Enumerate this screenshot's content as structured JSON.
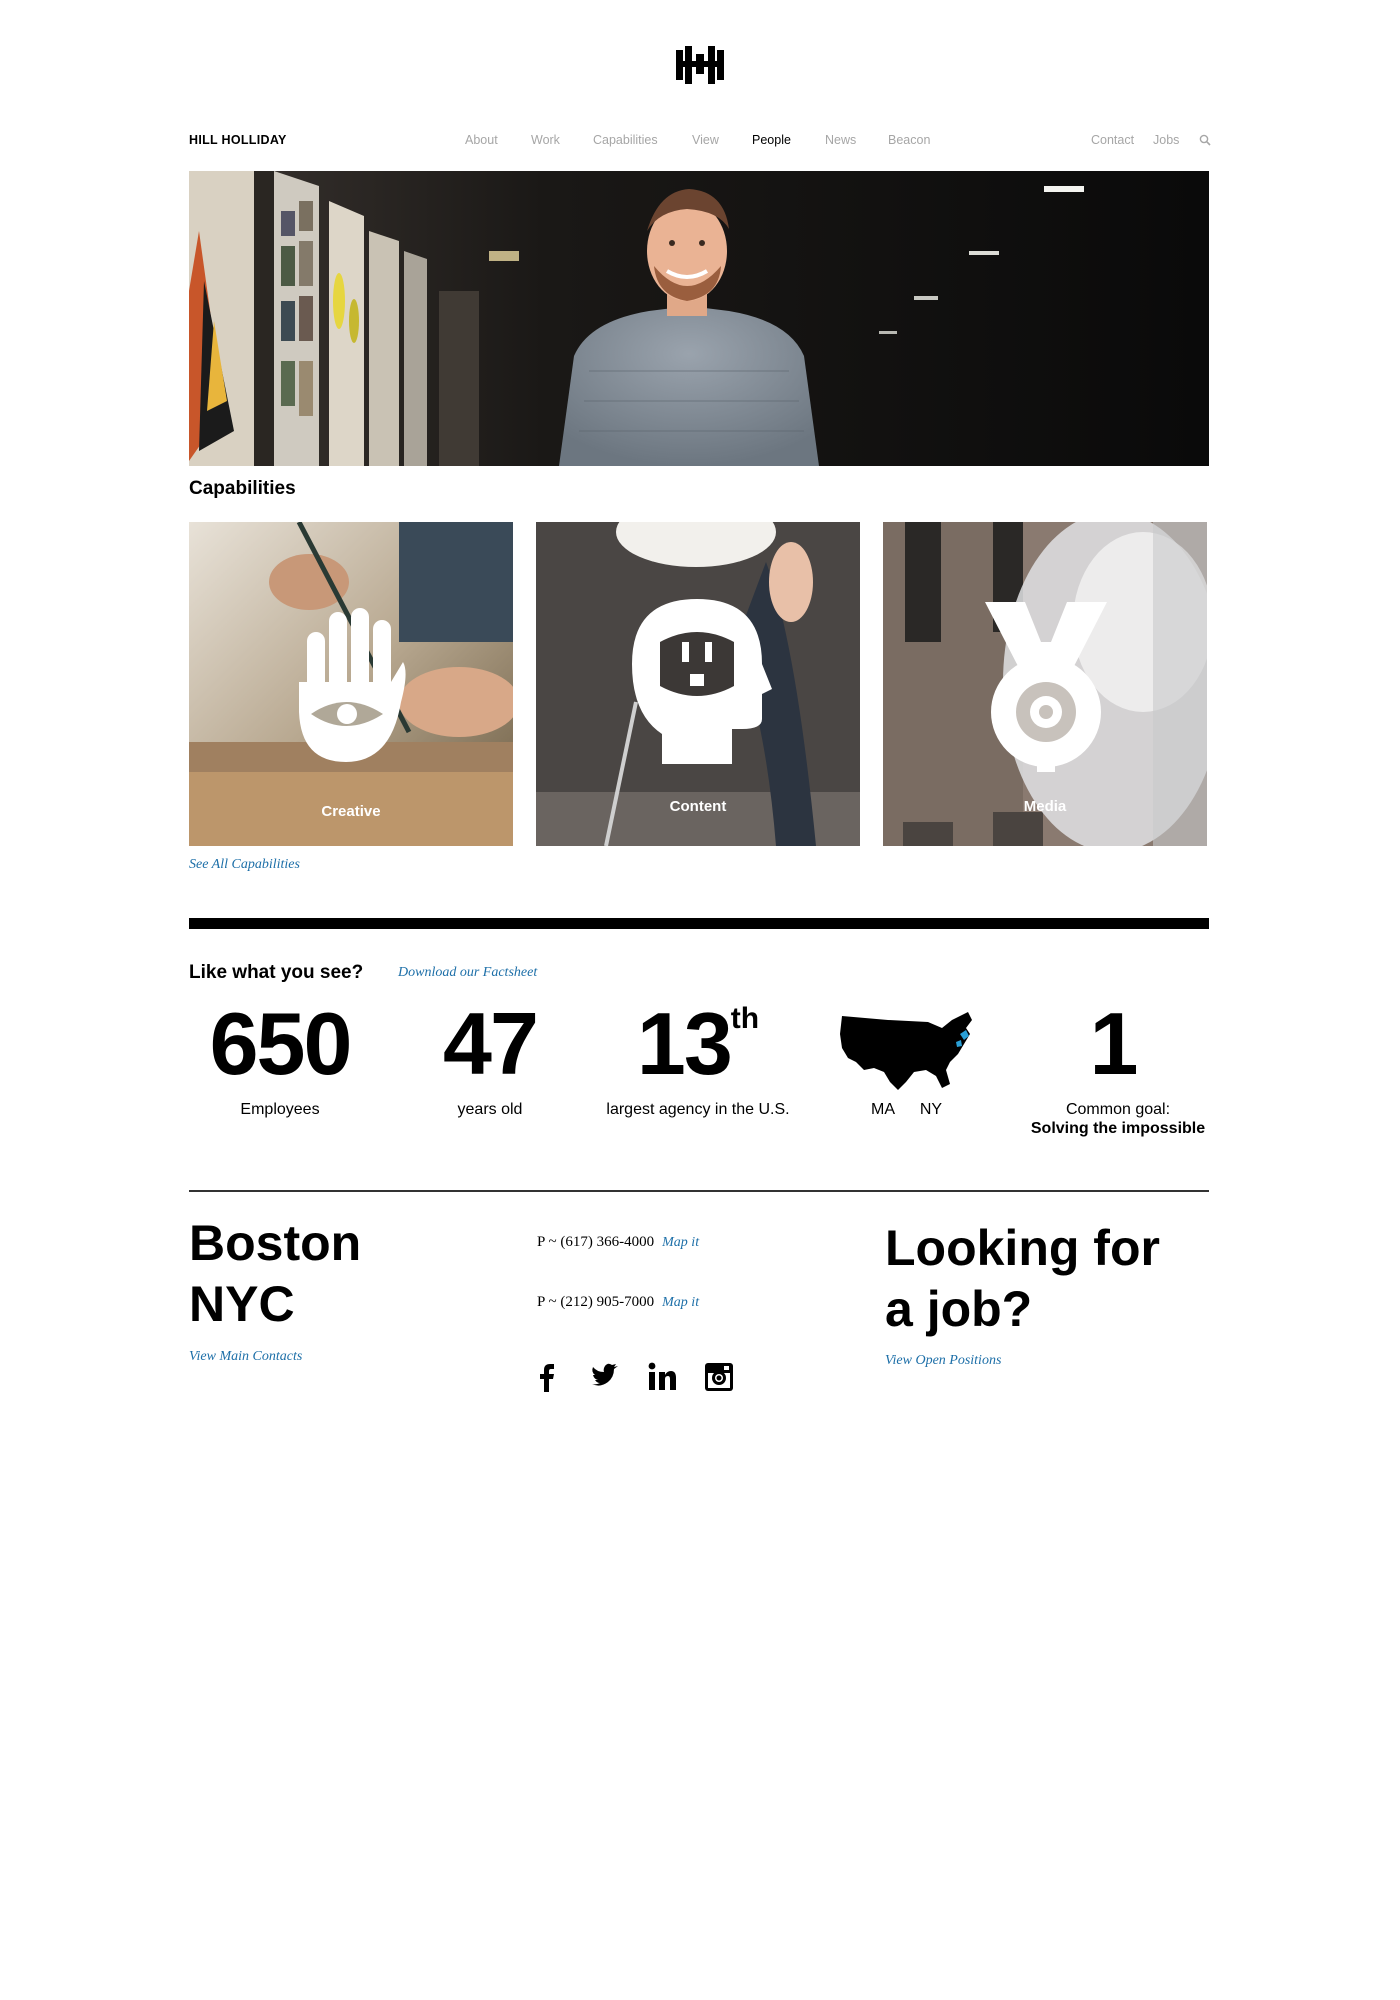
{
  "header": {
    "brand": "HILL HOLLIDAY",
    "nav": [
      "About",
      "Work",
      "Capabilities",
      "View",
      "People",
      "News",
      "Beacon"
    ],
    "active": "People",
    "utility": [
      "Contact",
      "Jobs"
    ],
    "icons": [
      "logo-hh",
      "search-icon"
    ]
  },
  "capabilities": {
    "title": "Capabilities",
    "cards": [
      {
        "label": "Creative",
        "icon": "hand-eye-icon"
      },
      {
        "label": "Content",
        "icon": "head-outlet-icon"
      },
      {
        "label": "Media",
        "icon": "target-funnel-icon"
      }
    ],
    "see_all": "See All Capabilities"
  },
  "stats": {
    "title": "Like what you see?",
    "factsheet_link": "Download our Factsheet",
    "items": [
      {
        "value": "650",
        "label": "Employees"
      },
      {
        "value": "47",
        "label": "years old"
      },
      {
        "value": "13",
        "sup": "th",
        "label": "largest agency in the U.S."
      },
      {
        "value": "",
        "label_a": "MA",
        "label_b": "NY",
        "icon": "usa-map-icon"
      },
      {
        "value": "1",
        "label": "Common goal:",
        "label_bold": "Solving the impossible"
      }
    ]
  },
  "contact": {
    "city1": "Boston",
    "city2": "NYC",
    "view_contacts": "View Main Contacts",
    "phone1": "P ~ (617) 366-4000",
    "phone2": "P ~ (212) 905-7000",
    "map_it": "Map it",
    "social": [
      "facebook-icon",
      "twitter-icon",
      "linkedin-icon",
      "instagram-icon"
    ],
    "job_line1": "Looking for",
    "job_line2": "a job?",
    "open_positions": "View Open Positions"
  },
  "colors": {
    "link": "#1d6fa8",
    "nav_inactive": "#a6a6a6",
    "map_highlight": "#2a9fd6"
  }
}
